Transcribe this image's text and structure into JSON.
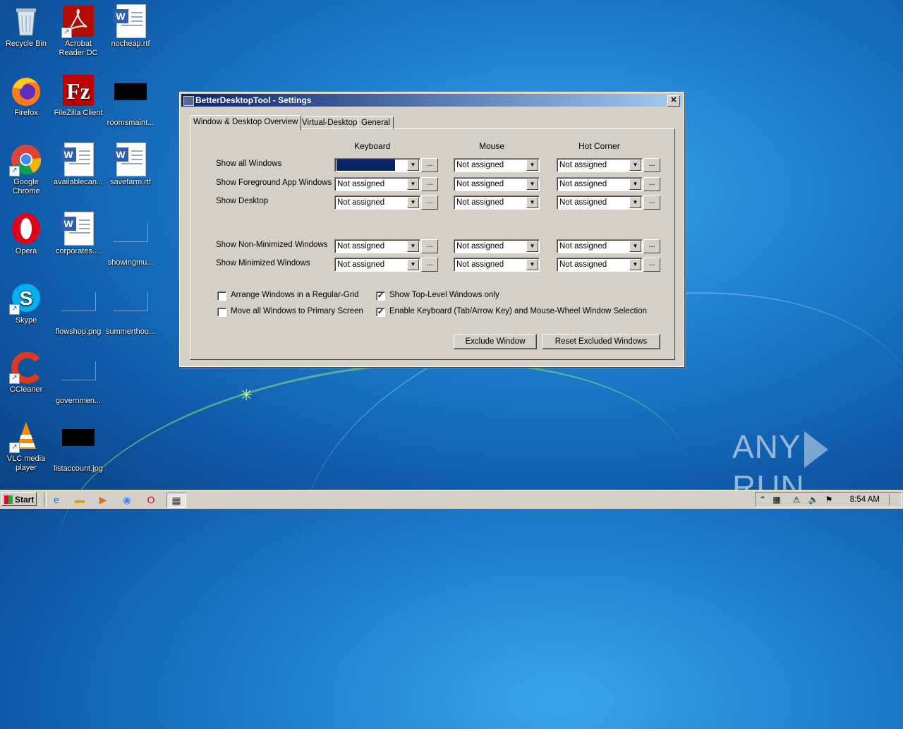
{
  "desktop": {
    "icons": [
      {
        "label": "Recycle Bin"
      },
      {
        "label": "Acrobat Reader DC"
      },
      {
        "label": "nocheap.rtf"
      },
      {
        "label": "Firefox"
      },
      {
        "label": "FileZilla Client"
      },
      {
        "label": "roomsmaint..."
      },
      {
        "label": "Google Chrome"
      },
      {
        "label": "availablecan..."
      },
      {
        "label": "savefarm.rtf"
      },
      {
        "label": "Opera"
      },
      {
        "label": "corporates...."
      },
      {
        "label": "showingmu..."
      },
      {
        "label": "Skype"
      },
      {
        "label": "flowshop.png"
      },
      {
        "label": "summerthou..."
      },
      {
        "label": "CCleaner"
      },
      {
        "label": "governmen..."
      },
      {
        "label": "VLC media player"
      },
      {
        "label": "listaccount.jpg"
      }
    ]
  },
  "window": {
    "title": "BetterDesktopTool - Settings",
    "close_glyph": "✕",
    "tabs": [
      {
        "label": "Window & Desktop Overview"
      },
      {
        "label": "Virtual-Desktop"
      },
      {
        "label": "General"
      }
    ],
    "columns": {
      "keyboard": "Keyboard",
      "mouse": "Mouse",
      "hot_corner": "Hot Corner"
    },
    "rows": [
      {
        "label": "Show all Windows"
      },
      {
        "label": "Show Foreground App Windows"
      },
      {
        "label": "Show Desktop"
      },
      {
        "label": "Show Non-Minimized Windows"
      },
      {
        "label": "Show Minimized Windows"
      }
    ],
    "combo_value": "Not assigned",
    "more_button": "...",
    "checkboxes": [
      {
        "label": "Arrange Windows in a Regular-Grid",
        "checked": false
      },
      {
        "label": "Move all Windows to Primary Screen",
        "checked": false
      },
      {
        "label": "Show Top-Level Windows only",
        "checked": true
      },
      {
        "label": "Enable Keyboard (Tab/Arrow Key) and Mouse-Wheel Window Selection",
        "checked": true
      }
    ],
    "buttons": {
      "exclude": "Exclude Window",
      "reset": "Reset Excluded Windows"
    }
  },
  "watermark": {
    "left": "ANY",
    "right": "RUN"
  },
  "taskbar": {
    "start_label": "Start",
    "clock": "8:54 AM"
  }
}
